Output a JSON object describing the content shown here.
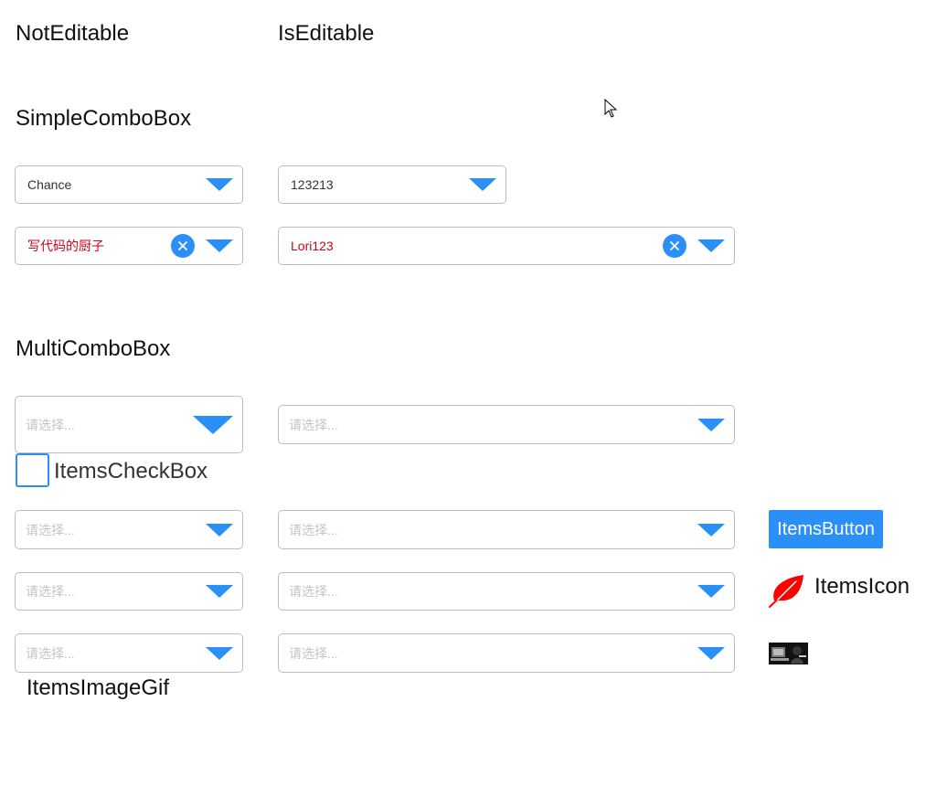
{
  "headers": {
    "not_editable": "NotEditable",
    "is_editable": "IsEditable"
  },
  "simple": {
    "title": "SimpleComboBox",
    "combo1_value": "Chance",
    "combo2_value": "123213",
    "combo3_value": "写代码的厨子",
    "combo4_value": "Lori123"
  },
  "multi": {
    "title": "MultiComboBox",
    "placeholder": "请选择..."
  },
  "items": {
    "checkbox_label": "ItemsCheckBox",
    "button_label": "ItemsButton",
    "icon_label": "ItemsIcon",
    "image_gif_label": "ItemsImageGif"
  },
  "icons": {
    "dropdown": "triangle-down-icon",
    "clear": "close-circle-icon",
    "leaf": "leaf-icon",
    "cursor": "mouse-pointer-icon"
  },
  "colors": {
    "accent": "#2a8ff7",
    "value_red": "#d0021b",
    "leaf_red": "#ff0000",
    "placeholder": "#c4c4c4"
  }
}
